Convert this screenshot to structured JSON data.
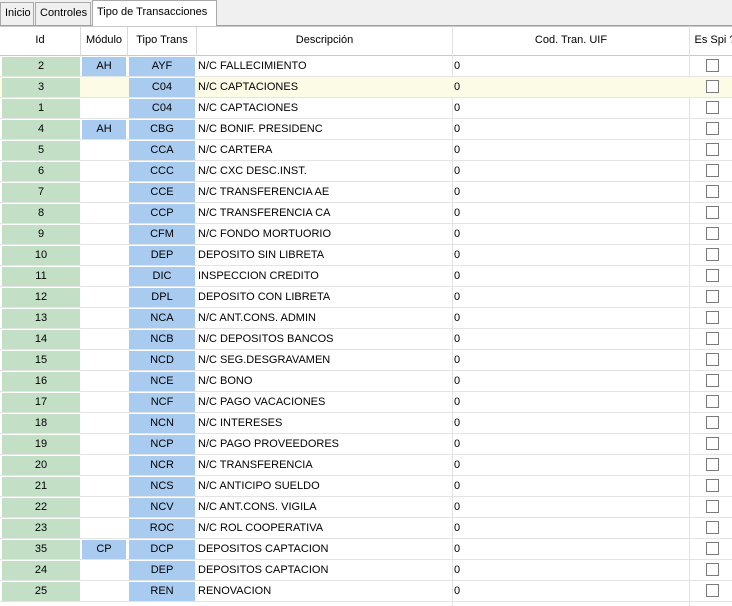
{
  "tabs": [
    {
      "label": "Inicio",
      "active": false
    },
    {
      "label": "Controles",
      "active": false
    },
    {
      "label": "Tipo de Transacciones",
      "active": true
    }
  ],
  "columns": {
    "id": "Id",
    "modulo": "Módulo",
    "tipo": "Tipo Trans",
    "descripcion": "Descripción",
    "uif": "Cod. Tran. UIF",
    "spi": "Es Spi ?"
  },
  "rows": [
    {
      "id": "2",
      "modulo": "AH",
      "tipo": "AYF",
      "descripcion": "N/C FALLECIMIENTO",
      "uif": "0",
      "spi": false
    },
    {
      "id": "3",
      "modulo": "",
      "tipo": "C04",
      "descripcion": "N/C CAPTACIONES",
      "uif": "0",
      "spi": false,
      "selected": true
    },
    {
      "id": "1",
      "modulo": "",
      "tipo": "C04",
      "descripcion": "N/C CAPTACIONES",
      "uif": "0",
      "spi": false
    },
    {
      "id": "4",
      "modulo": "AH",
      "tipo": "CBG",
      "descripcion": "N/C BONIF. PRESIDENC",
      "uif": "0",
      "spi": false
    },
    {
      "id": "5",
      "modulo": "",
      "tipo": "CCA",
      "descripcion": "N/C CARTERA",
      "uif": "0",
      "spi": false
    },
    {
      "id": "6",
      "modulo": "",
      "tipo": "CCC",
      "descripcion": "N/C CXC DESC.INST.",
      "uif": "0",
      "spi": false
    },
    {
      "id": "7",
      "modulo": "",
      "tipo": "CCE",
      "descripcion": "N/C TRANSFERENCIA AE",
      "uif": "0",
      "spi": false
    },
    {
      "id": "8",
      "modulo": "",
      "tipo": "CCP",
      "descripcion": "N/C TRANSFERENCIA CA",
      "uif": "0",
      "spi": false
    },
    {
      "id": "9",
      "modulo": "",
      "tipo": "CFM",
      "descripcion": "N/C FONDO MORTUORIO",
      "uif": "0",
      "spi": false
    },
    {
      "id": "10",
      "modulo": "",
      "tipo": "DEP",
      "descripcion": "DEPOSITO SIN LIBRETA",
      "uif": "0",
      "spi": false
    },
    {
      "id": "11",
      "modulo": "",
      "tipo": "DIC",
      "descripcion": "INSPECCION CREDITO",
      "uif": "0",
      "spi": false
    },
    {
      "id": "12",
      "modulo": "",
      "tipo": "DPL",
      "descripcion": "DEPOSITO CON LIBRETA",
      "uif": "0",
      "spi": false
    },
    {
      "id": "13",
      "modulo": "",
      "tipo": "NCA",
      "descripcion": "N/C ANT.CONS. ADMIN",
      "uif": "0",
      "spi": false
    },
    {
      "id": "14",
      "modulo": "",
      "tipo": "NCB",
      "descripcion": "N/C DEPOSITOS BANCOS",
      "uif": "0",
      "spi": false
    },
    {
      "id": "15",
      "modulo": "",
      "tipo": "NCD",
      "descripcion": "N/C SEG.DESGRAVAMEN",
      "uif": "0",
      "spi": false
    },
    {
      "id": "16",
      "modulo": "",
      "tipo": "NCE",
      "descripcion": "N/C BONO",
      "uif": "0",
      "spi": false
    },
    {
      "id": "17",
      "modulo": "",
      "tipo": "NCF",
      "descripcion": "N/C PAGO VACACIONES",
      "uif": "0",
      "spi": false
    },
    {
      "id": "18",
      "modulo": "",
      "tipo": "NCN",
      "descripcion": "N/C INTERESES",
      "uif": "0",
      "spi": false
    },
    {
      "id": "19",
      "modulo": "",
      "tipo": "NCP",
      "descripcion": "N/C PAGO PROVEEDORES",
      "uif": "0",
      "spi": false
    },
    {
      "id": "20",
      "modulo": "",
      "tipo": "NCR",
      "descripcion": "N/C TRANSFERENCIA",
      "uif": "0",
      "spi": false
    },
    {
      "id": "21",
      "modulo": "",
      "tipo": "NCS",
      "descripcion": "N/C ANTICIPO SUELDO",
      "uif": "0",
      "spi": false
    },
    {
      "id": "22",
      "modulo": "",
      "tipo": "NCV",
      "descripcion": "N/C ANT.CONS. VIGILA",
      "uif": "0",
      "spi": false
    },
    {
      "id": "23",
      "modulo": "",
      "tipo": "ROC",
      "descripcion": "N/C ROL COOPERATIVA",
      "uif": "0",
      "spi": false
    },
    {
      "id": "35",
      "modulo": "CP",
      "tipo": "DCP",
      "descripcion": "DEPOSITOS CAPTACION",
      "uif": "0",
      "spi": false
    },
    {
      "id": "24",
      "modulo": "",
      "tipo": "DEP",
      "descripcion": "DEPOSITOS CAPTACION",
      "uif": "0",
      "spi": false
    },
    {
      "id": "25",
      "modulo": "",
      "tipo": "REN",
      "descripcion": "RENOVACION",
      "uif": "0",
      "spi": false
    }
  ]
}
